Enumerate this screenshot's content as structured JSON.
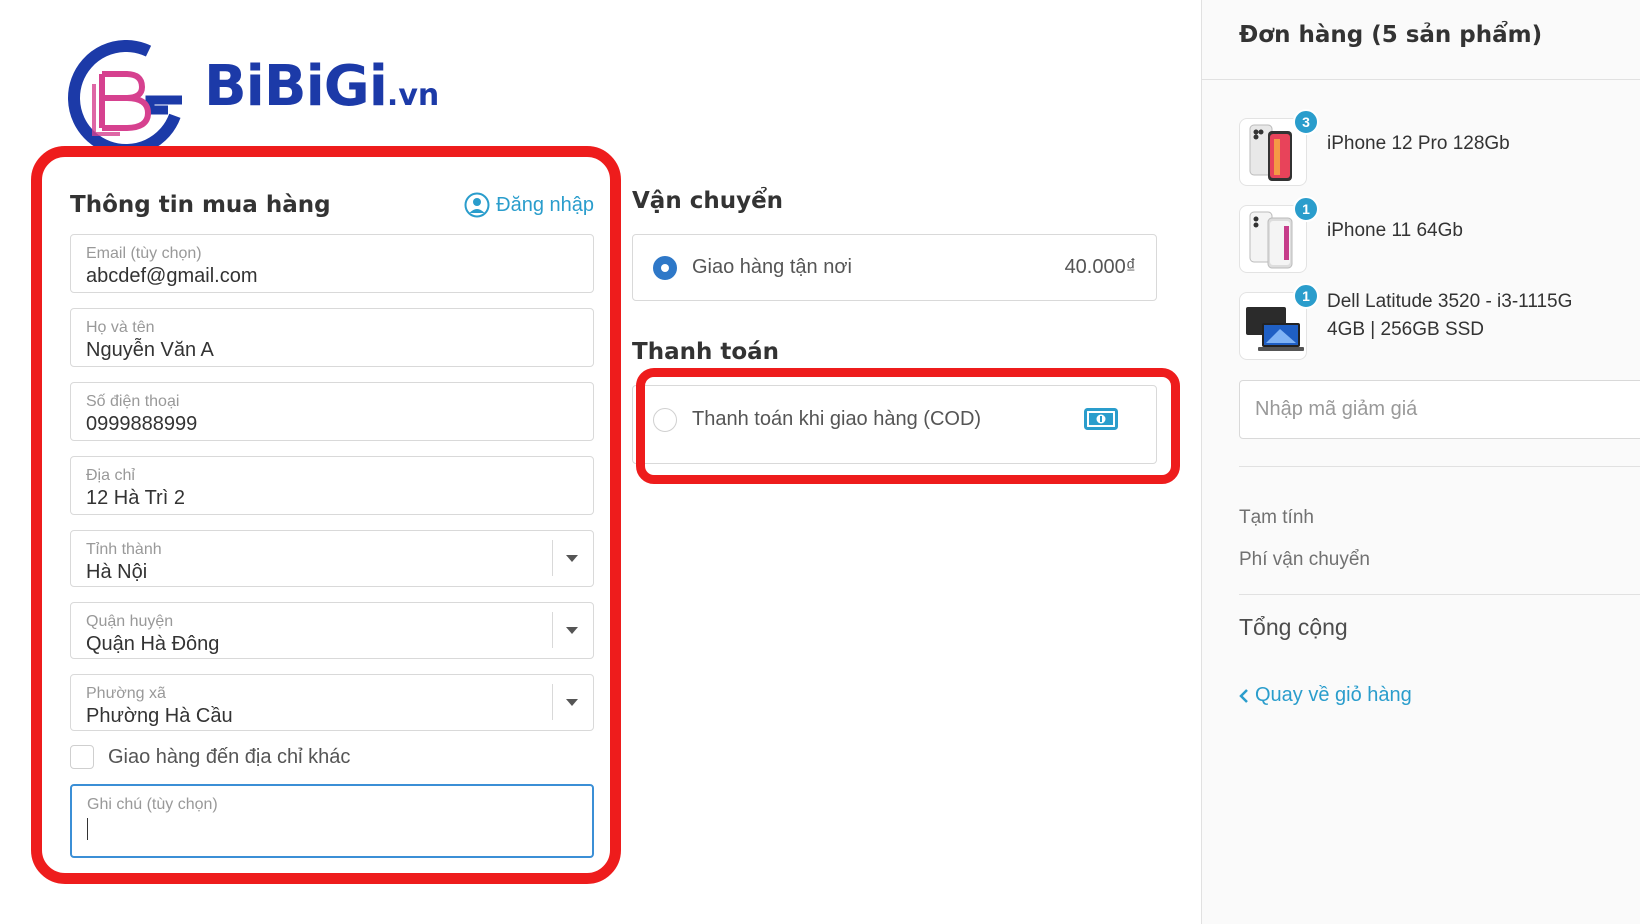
{
  "brand": {
    "wordmark": "BiBiGi",
    "suffix": ".vn",
    "color": "#1c3aa8"
  },
  "customer_info": {
    "title": "Thông tin mua hàng",
    "login_label": "Đăng nhập",
    "email": {
      "label": "Email (tùy chọn)",
      "value": "abcdef@gmail.com"
    },
    "full_name": {
      "label": "Họ và tên",
      "value": "Nguyễn Văn A"
    },
    "phone": {
      "label": "Số điện thoại",
      "value": "0999888999"
    },
    "address": {
      "label": "Địa chỉ",
      "value": "12 Hà Trì 2"
    },
    "province": {
      "label": "Tỉnh thành",
      "value": "Hà Nội"
    },
    "district": {
      "label": "Quận huyện",
      "value": "Quận Hà Đông"
    },
    "ward": {
      "label": "Phường xã",
      "value": "Phường Hà Cầu"
    },
    "other_address_label": "Giao hàng đến địa chỉ khác",
    "note": {
      "label": "Ghi chú (tùy chọn)",
      "value": ""
    }
  },
  "shipping": {
    "title": "Vận chuyển",
    "option": {
      "label": "Giao hàng tận nơi",
      "price": "40.000₫",
      "selected": true
    }
  },
  "payment": {
    "title": "Thanh toán",
    "option": {
      "label": "Thanh toán khi giao hàng (COD)",
      "selected": false,
      "icon": "cash-icon"
    }
  },
  "order": {
    "title": "Đơn hàng (5 sản phẩm)",
    "items": [
      {
        "name": "iPhone 12 Pro 128Gb",
        "quantity": "3"
      },
      {
        "name": "iPhone 11 64Gb",
        "quantity": "1"
      },
      {
        "name_line1": "Dell Latitude 3520 - i3-1115G",
        "name_line2": "4GB | 256GB SSD",
        "quantity": "1"
      }
    ],
    "discount_placeholder": "Nhập mã giảm giá",
    "subtotal_label": "Tạm tính",
    "shipping_fee_label": "Phí vận chuyển",
    "total_label": "Tổng cộng",
    "back_label": "Quay về giỏ hàng"
  },
  "colors": {
    "accent": "#2a9dcc",
    "radio_selected": "#2e78c8",
    "highlight": "#ee1c1c"
  }
}
